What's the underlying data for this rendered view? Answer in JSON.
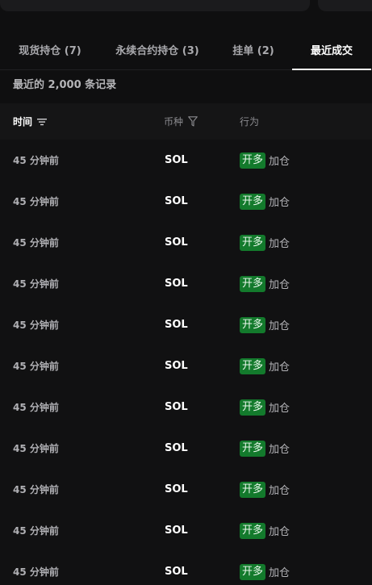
{
  "tabs": [
    {
      "label": "现货持仓 (7)",
      "active": false
    },
    {
      "label": "永续合约持仓 (3)",
      "active": false
    },
    {
      "label": "挂单 (2)",
      "active": false
    },
    {
      "label": "最近成交",
      "active": true
    }
  ],
  "record_count": "最近的 2,000 条记录",
  "table": {
    "headers": {
      "time": "时间",
      "coin": "币种",
      "action": "行为"
    },
    "rows": [
      {
        "time": "45 分钟前",
        "coin": "SOL",
        "badge": "开多",
        "action": "加仓"
      },
      {
        "time": "45 分钟前",
        "coin": "SOL",
        "badge": "开多",
        "action": "加仓"
      },
      {
        "time": "45 分钟前",
        "coin": "SOL",
        "badge": "开多",
        "action": "加仓"
      },
      {
        "time": "45 分钟前",
        "coin": "SOL",
        "badge": "开多",
        "action": "加仓"
      },
      {
        "time": "45 分钟前",
        "coin": "SOL",
        "badge": "开多",
        "action": "加仓"
      },
      {
        "time": "45 分钟前",
        "coin": "SOL",
        "badge": "开多",
        "action": "加仓"
      },
      {
        "time": "45 分钟前",
        "coin": "SOL",
        "badge": "开多",
        "action": "加仓"
      },
      {
        "time": "45 分钟前",
        "coin": "SOL",
        "badge": "开多",
        "action": "加仓"
      },
      {
        "time": "45 分钟前",
        "coin": "SOL",
        "badge": "开多",
        "action": "加仓"
      },
      {
        "time": "45 分钟前",
        "coin": "SOL",
        "badge": "开多",
        "action": "加仓"
      },
      {
        "time": "45 分钟前",
        "coin": "SOL",
        "badge": "开多",
        "action": "加仓"
      }
    ]
  },
  "icons": {
    "sort": "sort-icon",
    "filter": "filter-icon"
  },
  "colors": {
    "background": "#0f0f10",
    "badge_green": "#137a2c",
    "active_tab": "#ffffff"
  }
}
